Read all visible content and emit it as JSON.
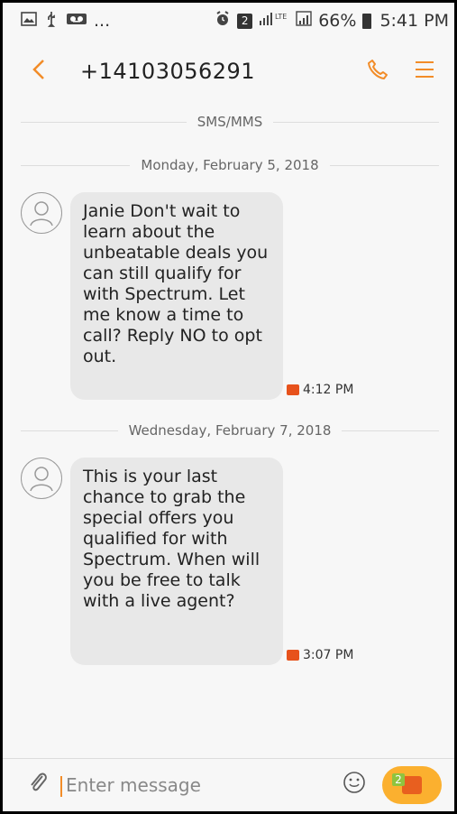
{
  "status_bar": {
    "left_icons": [
      "gallery-icon",
      "usb-icon",
      "voicemail-icon"
    ],
    "ellipsis": "...",
    "signal_badge": "LTE",
    "sim_number": "2",
    "battery_percent": "66%",
    "time": "5:41 PM"
  },
  "appbar": {
    "phone_number": "+14103056291"
  },
  "dividers": {
    "sms_label": "SMS/MMS",
    "date1": "Monday, February 5, 2018",
    "date2": "Wednesday, February 7, 2018"
  },
  "messages": [
    {
      "text": "Janie Don't wait to learn about the unbeatable deals you can still qualify for with Spectrum. Let me know a time to call? Reply NO to opt out.",
      "time": "4:12 PM"
    },
    {
      "text": "This is your last chance to grab the special offers you qualified for with Spectrum. When will you be free to talk with a live agent?",
      "time": "3:07 PM"
    }
  ],
  "composer": {
    "placeholder": "Enter message",
    "send_count": "2"
  },
  "colors": {
    "accent_orange": "#f28c28",
    "send_yellow": "#fbb02f",
    "message_icon": "#e7521c",
    "count_green": "#8fc43f"
  }
}
